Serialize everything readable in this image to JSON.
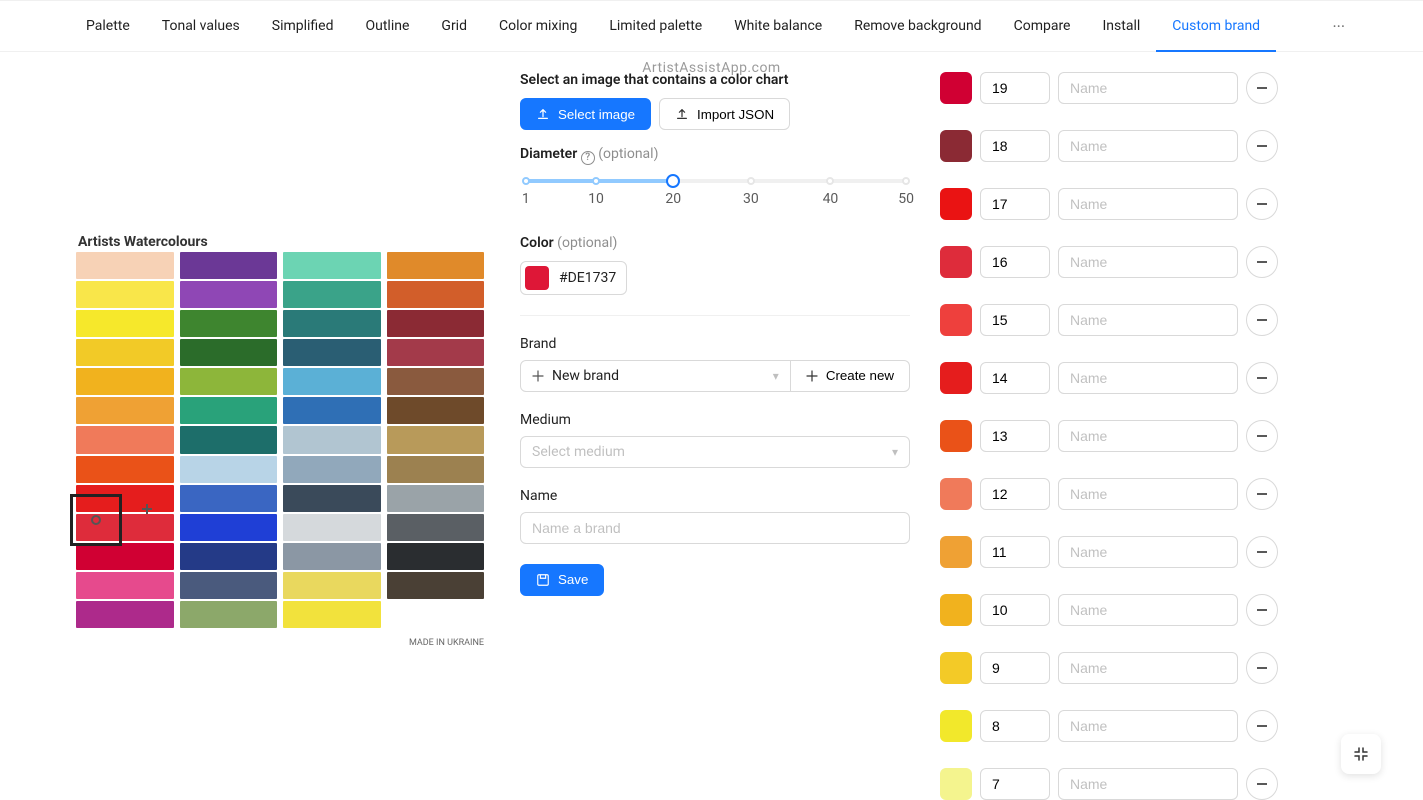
{
  "watermark": "ArtistAssistApp.com",
  "tabs": [
    {
      "label": "Palette"
    },
    {
      "label": "Tonal values"
    },
    {
      "label": "Simplified"
    },
    {
      "label": "Outline"
    },
    {
      "label": "Grid"
    },
    {
      "label": "Color mixing"
    },
    {
      "label": "Limited palette"
    },
    {
      "label": "White balance"
    },
    {
      "label": "Remove background"
    },
    {
      "label": "Compare"
    },
    {
      "label": "Install"
    },
    {
      "label": "Custom brand",
      "active": true
    }
  ],
  "tabs_more": "···",
  "upload": {
    "title": "Select an image that contains a color chart",
    "select_btn": "Select image",
    "import_btn": "Import JSON"
  },
  "diameter": {
    "label": "Diameter",
    "optional": "(optional)",
    "value": 20,
    "marks": [
      1,
      10,
      20,
      30,
      40,
      50
    ]
  },
  "color": {
    "label": "Color",
    "optional": "(optional)",
    "hex": "#DE1737"
  },
  "brand": {
    "label": "Brand",
    "new_brand": "New brand",
    "create_new": "Create new"
  },
  "medium": {
    "label": "Medium",
    "placeholder": "Select medium"
  },
  "name": {
    "label": "Name",
    "placeholder": "Name a brand"
  },
  "save_btn": "Save",
  "color_list_placeholder": "Name",
  "colors": [
    {
      "num": "19",
      "hex": "#d00033"
    },
    {
      "num": "18",
      "hex": "#8b2a34"
    },
    {
      "num": "17",
      "hex": "#ea1313"
    },
    {
      "num": "16",
      "hex": "#de2c3b"
    },
    {
      "num": "15",
      "hex": "#ee403d"
    },
    {
      "num": "14",
      "hex": "#e51d1d"
    },
    {
      "num": "13",
      "hex": "#ea5218"
    },
    {
      "num": "12",
      "hex": "#f07a5a"
    },
    {
      "num": "11",
      "hex": "#efa134"
    },
    {
      "num": "10",
      "hex": "#f1b21e"
    },
    {
      "num": "9",
      "hex": "#f3ca27"
    },
    {
      "num": "8",
      "hex": "#f2e82b"
    },
    {
      "num": "7",
      "hex": "#f4f48e"
    }
  ],
  "chart_title": "Artists Watercolours",
  "chart_made": "MADE IN UKRAINE",
  "chart_cols": [
    [
      "#f7d2b6",
      "#f9e64a",
      "#f6e82b",
      "#f2ca27",
      "#f1b21e",
      "#efa134",
      "#f07a5a",
      "#ea5218",
      "#e51d1d",
      "#de2c3b",
      "#d00033",
      "#e64a8d",
      "#ad2a8b"
    ],
    [
      "#6b3896",
      "#8f47b5",
      "#3e852f",
      "#2b6c2a",
      "#8db63a",
      "#29a27a",
      "#1d6e6a",
      "#b8d4e7",
      "#3a66c2",
      "#1f3fd6",
      "#243a87",
      "#4a5a7d",
      "#8ca86a"
    ],
    [
      "#6cd4b3",
      "#3aa389",
      "#2a7a78",
      "#2a5e73",
      "#5bb0d6",
      "#2f6fb5",
      "#b1c5d1",
      "#91a8bb",
      "#3a4a5a",
      "#d5d9dc",
      "#8b97a4",
      "#e9d85e",
      "#f2e23c"
    ],
    [
      "#e08a2a",
      "#d25e2a",
      "#8b2a34",
      "#a33a4a",
      "#8a5a3e",
      "#6e4a2a",
      "#b89a5a",
      "#9c8150",
      "#9aa3a8",
      "#5a5f64",
      "#2a2d30",
      "#4a4035",
      ""
    ]
  ]
}
